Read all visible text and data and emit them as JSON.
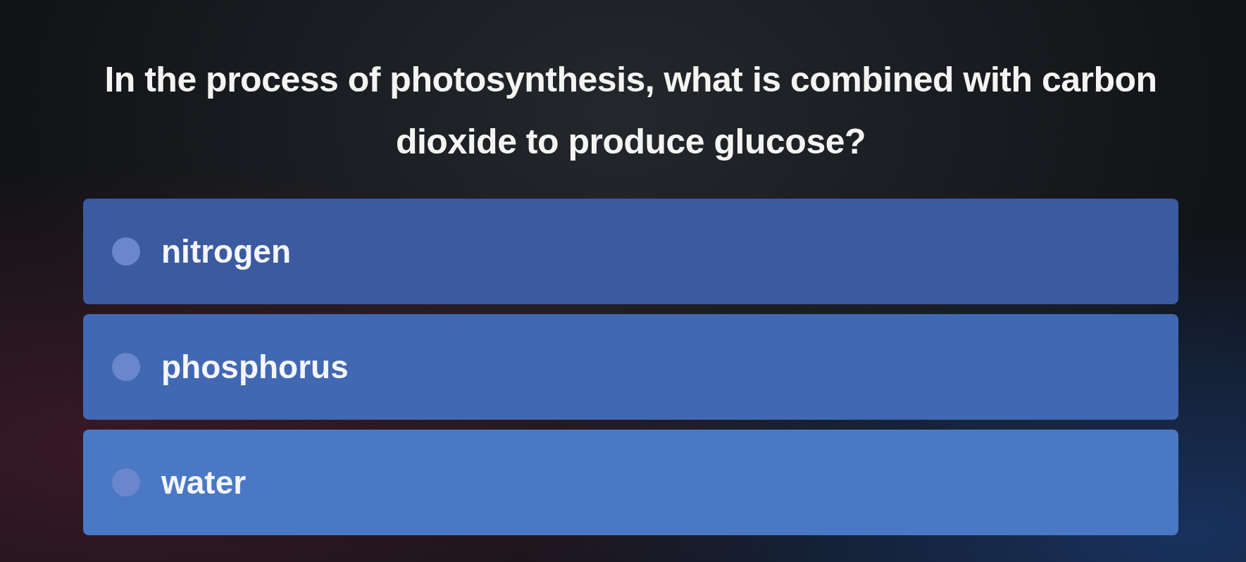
{
  "question": "In the process of photosynthesis, what is combined with carbon dioxide to produce glucose?",
  "options": [
    {
      "label": "nitrogen",
      "selected": false
    },
    {
      "label": "phosphorus",
      "selected": false
    },
    {
      "label": "water",
      "selected": false
    }
  ]
}
